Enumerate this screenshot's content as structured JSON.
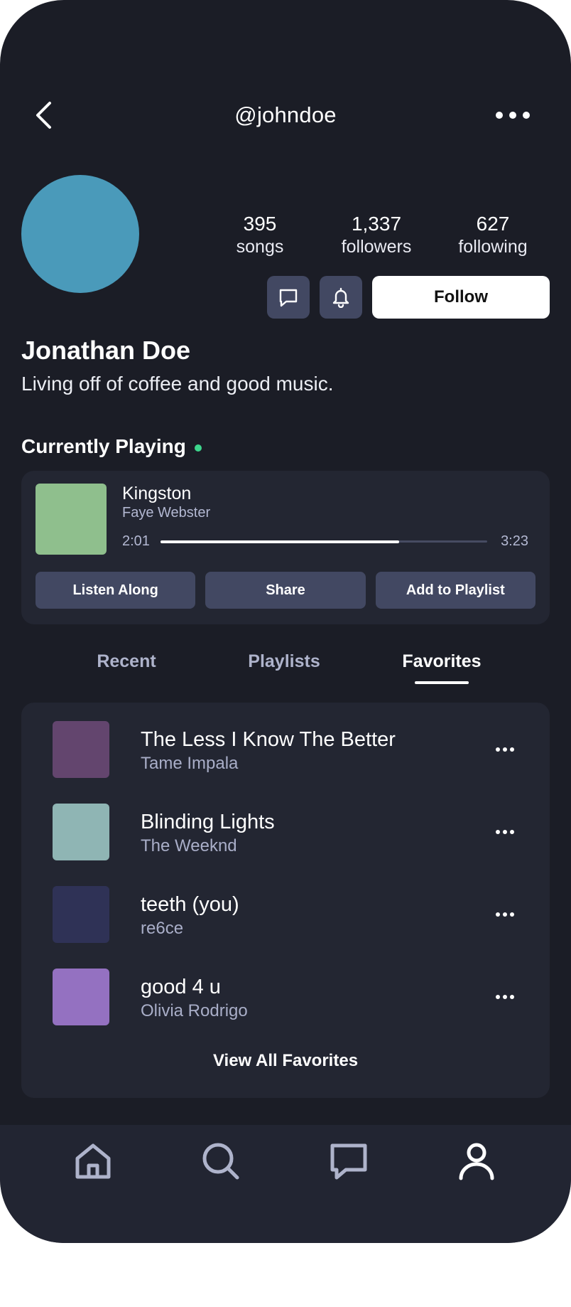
{
  "header": {
    "handle": "@johndoe"
  },
  "profile": {
    "display_name": "Jonathan Doe",
    "bio": "Living off of coffee and good music.",
    "avatar_color": "#4a9aba",
    "stats": [
      {
        "value": "395",
        "label": "songs"
      },
      {
        "value": "1,337",
        "label": "followers"
      },
      {
        "value": "627",
        "label": "following"
      }
    ],
    "follow_label": "Follow"
  },
  "now_playing": {
    "section_title": "Currently Playing",
    "live_color": "#3dd68c",
    "song": "Kingston",
    "artist": "Faye Webster",
    "art_color": "#8fbf8d",
    "elapsed": "2:01",
    "duration": "3:23",
    "progress": 0.73,
    "actions": [
      "Listen Along",
      "Share",
      "Add to Playlist"
    ]
  },
  "tabs": [
    {
      "label": "Recent",
      "active": false
    },
    {
      "label": "Playlists",
      "active": false
    },
    {
      "label": "Favorites",
      "active": true
    }
  ],
  "favorites": {
    "items": [
      {
        "title": "The Less I Know The Better",
        "artist": "Tame Impala",
        "art_color": "#63456e"
      },
      {
        "title": "Blinding Lights",
        "artist": "The Weeknd",
        "art_color": "#8fb5b4"
      },
      {
        "title": "teeth (you)",
        "artist": "re6ce",
        "art_color": "#2f3256"
      },
      {
        "title": "good 4 u",
        "artist": "Olivia Rodrigo",
        "art_color": "#9471c1"
      }
    ],
    "view_all_label": "View All Favorites"
  },
  "bottom_nav": {
    "items": [
      "home-icon",
      "search-icon",
      "chat-icon",
      "profile-icon"
    ],
    "active": "profile-icon"
  },
  "colors": {
    "background": "#1b1d26",
    "card": "#232632",
    "button": "#424862",
    "muted_text": "#aeb3cb"
  }
}
